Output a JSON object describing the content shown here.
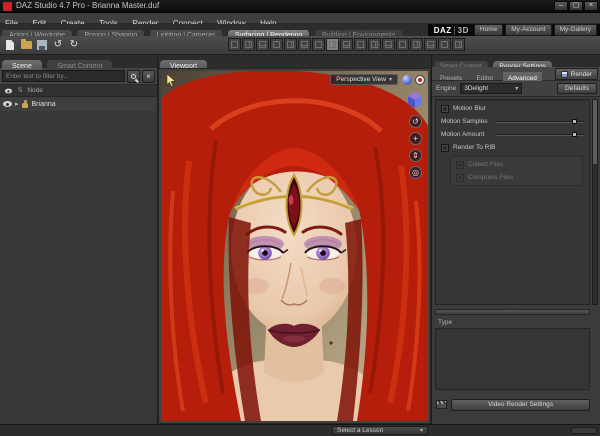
{
  "colors": {
    "daz_red": "#cf2027",
    "hair_red": "#b51e0b",
    "panel_gray": "#3b3b3b",
    "active_tab": "#6e6e6e"
  },
  "window": {
    "title": "DAZ Studio 4.7 Pro - Brianna Master.duf",
    "minimize": "–",
    "maximize": "▢",
    "close": "×"
  },
  "menu": {
    "items": [
      "File",
      "Edit",
      "Create",
      "Tools",
      "Render",
      "Connect",
      "Window",
      "Help"
    ]
  },
  "activity": {
    "tabs": [
      {
        "label": "Actors | Wardrobe"
      },
      {
        "label": "Posing | Shaping"
      },
      {
        "label": "Lighting | Cameras"
      },
      {
        "label": "Surfacing | Rendering"
      },
      {
        "label": "Building | Environments"
      }
    ],
    "active_index": 3
  },
  "brand": {
    "daz": "DAZ",
    "threed": "3D",
    "home": "Home",
    "account": "My-Account",
    "gallery": "My-Gallery"
  },
  "icons": {
    "undo": "↺",
    "redo": "↻",
    "dropdown": "▾",
    "clear": "×",
    "expander": "▸",
    "orbit": "↺",
    "pan": "+",
    "dolly": "⇕",
    "frame": "◎",
    "dots": "· · ·"
  },
  "scene_panel": {
    "tab_scene": "Scene",
    "tab_other": "Smart Content",
    "search_placeholder": "Enter text to filter by...",
    "header_s": "S",
    "header_node": "Node",
    "item": "Brianna"
  },
  "viewport": {
    "tab": "Viewport",
    "camera": "Perspective View"
  },
  "render_panel": {
    "tab_inactive": "Smart Content",
    "tab_active": "Render Settings",
    "subtabs": [
      "Presets",
      "Editor",
      "Advanced"
    ],
    "active_subtab": 2,
    "render_button": "Render",
    "engine_label": "Engine",
    "engine_value": "3Delight",
    "defaults_button": "Defaults",
    "opt_motion_blur": "Motion Blur",
    "opt_motion_samples": "Motion Samples",
    "opt_motion_amount": "Motion Amount",
    "opt_render_to_rib": "Render To RIB",
    "disabled_opt_1": "Collect Files",
    "disabled_opt_2": "Compress Files",
    "type_label": "Type",
    "video_button": "Video Render Settings"
  },
  "status": {
    "lesson": "Select a Lesson"
  }
}
